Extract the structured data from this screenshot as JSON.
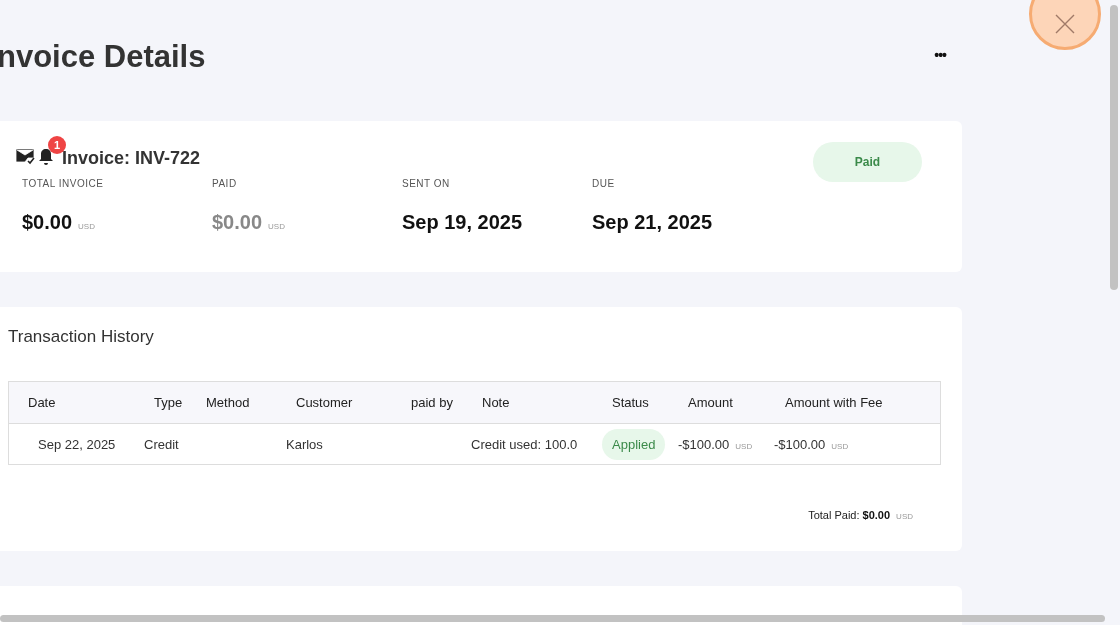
{
  "page": {
    "title": "nvoice Details",
    "menu_icon": "•••"
  },
  "invoice": {
    "notification_count": "1",
    "title": "Invoice: INV-722",
    "status": "Paid",
    "stats": [
      {
        "label": "TOTAL INVOICE",
        "value": "$0.00",
        "currency": "USD",
        "muted": false
      },
      {
        "label": "PAID",
        "value": "$0.00",
        "currency": "USD",
        "muted": true
      },
      {
        "label": "SENT ON",
        "value": "Sep 19, 2025",
        "muted": false
      },
      {
        "label": "DUE",
        "value": "Sep 21, 2025",
        "muted": false
      }
    ]
  },
  "transactions": {
    "title": "Transaction History",
    "columns": [
      "Date",
      "Type",
      "Method",
      "Customer",
      "paid by",
      "Note",
      "Status",
      "Amount",
      "Amount with Fee"
    ],
    "rows": [
      {
        "date": "Sep 22, 2025",
        "type": "Credit",
        "customer": "Karlos",
        "note": "Credit used: 100.0",
        "status": "Applied",
        "amount": "-$100.00",
        "amount_currency": "USD",
        "amount_fee": "-$100.00",
        "amount_fee_currency": "USD"
      }
    ],
    "total_label": "Total Paid:",
    "total_value": "$0.00",
    "total_currency": "USD"
  }
}
